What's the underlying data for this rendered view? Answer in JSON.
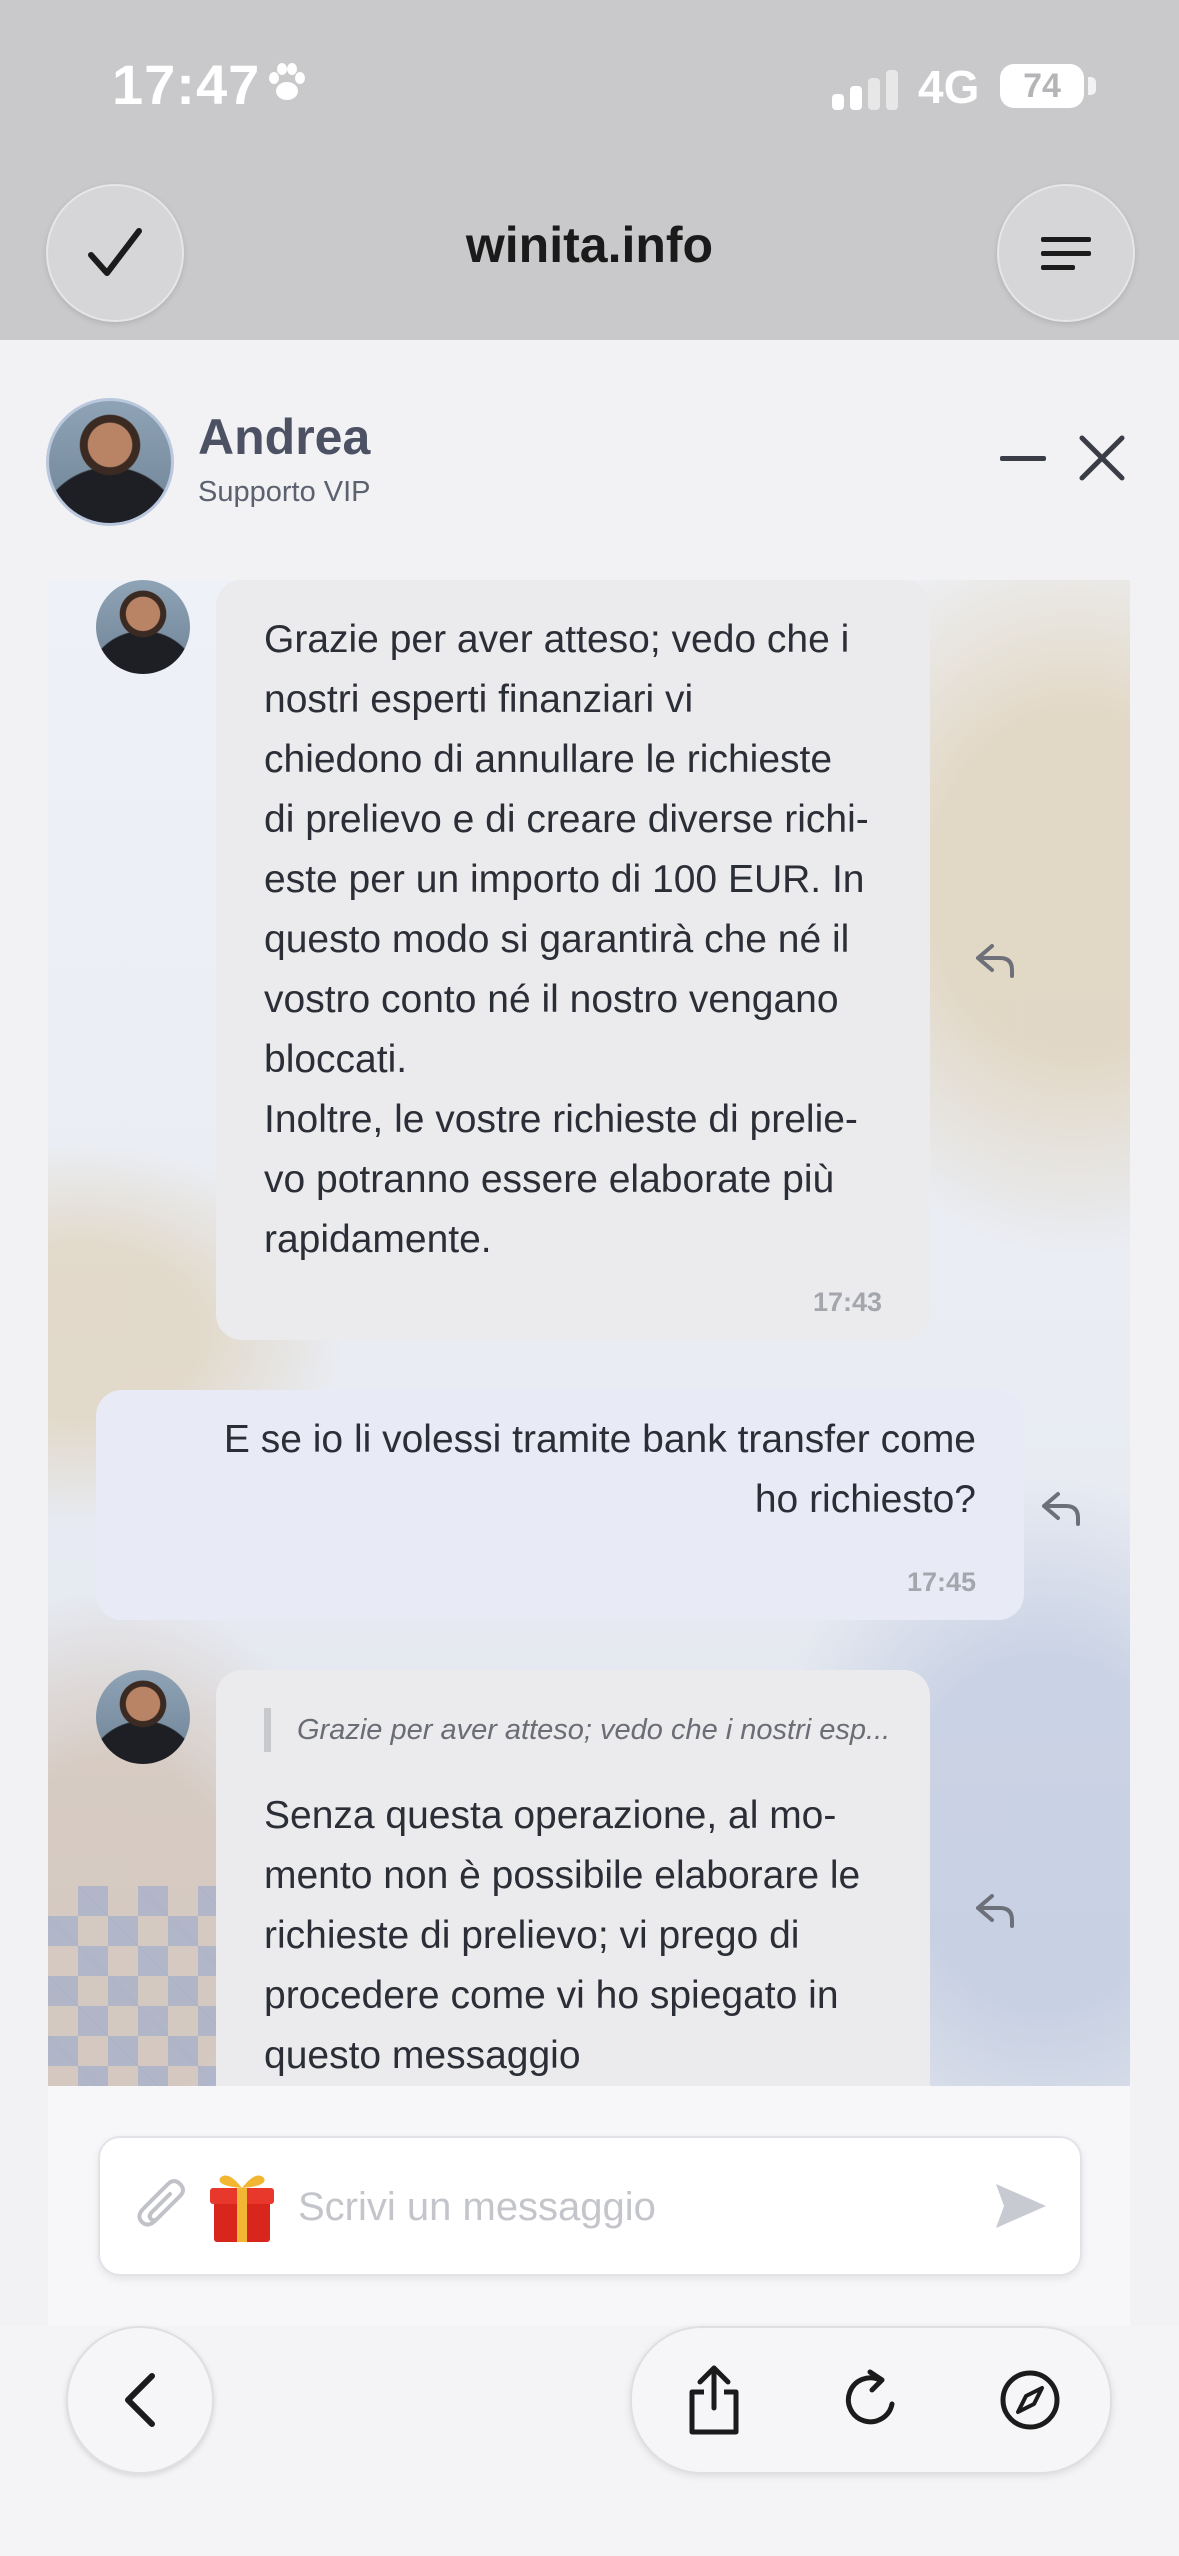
{
  "status_bar": {
    "time": "17:47",
    "network": "4G",
    "battery": "74"
  },
  "browser": {
    "url_title": "winita.info"
  },
  "chat_header": {
    "agent_name": "Andrea",
    "agent_role": "Supporto VIP"
  },
  "messages": [
    {
      "direction": "incoming",
      "text": "Grazie per aver atteso; vedo che i\nnostri esperti finanziari vi\nchiedono di annullare le richieste\ndi prelievo e di creare diverse richi-\neste per un importo di 100 EUR. In\nquesto modo si garantirà che né il\nvostro conto né il nostro vengano\nbloccati.\nInoltre, le vostre richieste di prelie-\nvo potranno essere elaborate più\nrapidamente.",
      "time": "17:43"
    },
    {
      "direction": "outgoing",
      "text": "E se io li volessi tramite bank transfer come\nho richiesto?",
      "time": "17:45"
    },
    {
      "direction": "incoming",
      "quote": "Grazie per aver atteso; vedo che i nostri esp...",
      "text": "Senza questa operazione, al mo-\nmento non è possibile elaborare le\nrichieste di prelievo; vi prego di\nprocedere come vi ho spiegato in\nquesto messaggio"
    }
  ],
  "composer": {
    "placeholder": "Scrivi un messaggio"
  },
  "icons": {
    "top_left": "checkmark-icon",
    "top_right": "menu-icon",
    "attach": "paperclip-icon",
    "gift": "gift-icon",
    "send": "send-icon",
    "back": "chevron-left-icon",
    "share": "share-icon",
    "reload": "reload-icon",
    "compass": "compass-icon"
  },
  "colors": {
    "incoming_bubble": "#ebebed",
    "outgoing_bubble": "#e8ebf6",
    "browser_chrome": "#c9c9cb"
  }
}
